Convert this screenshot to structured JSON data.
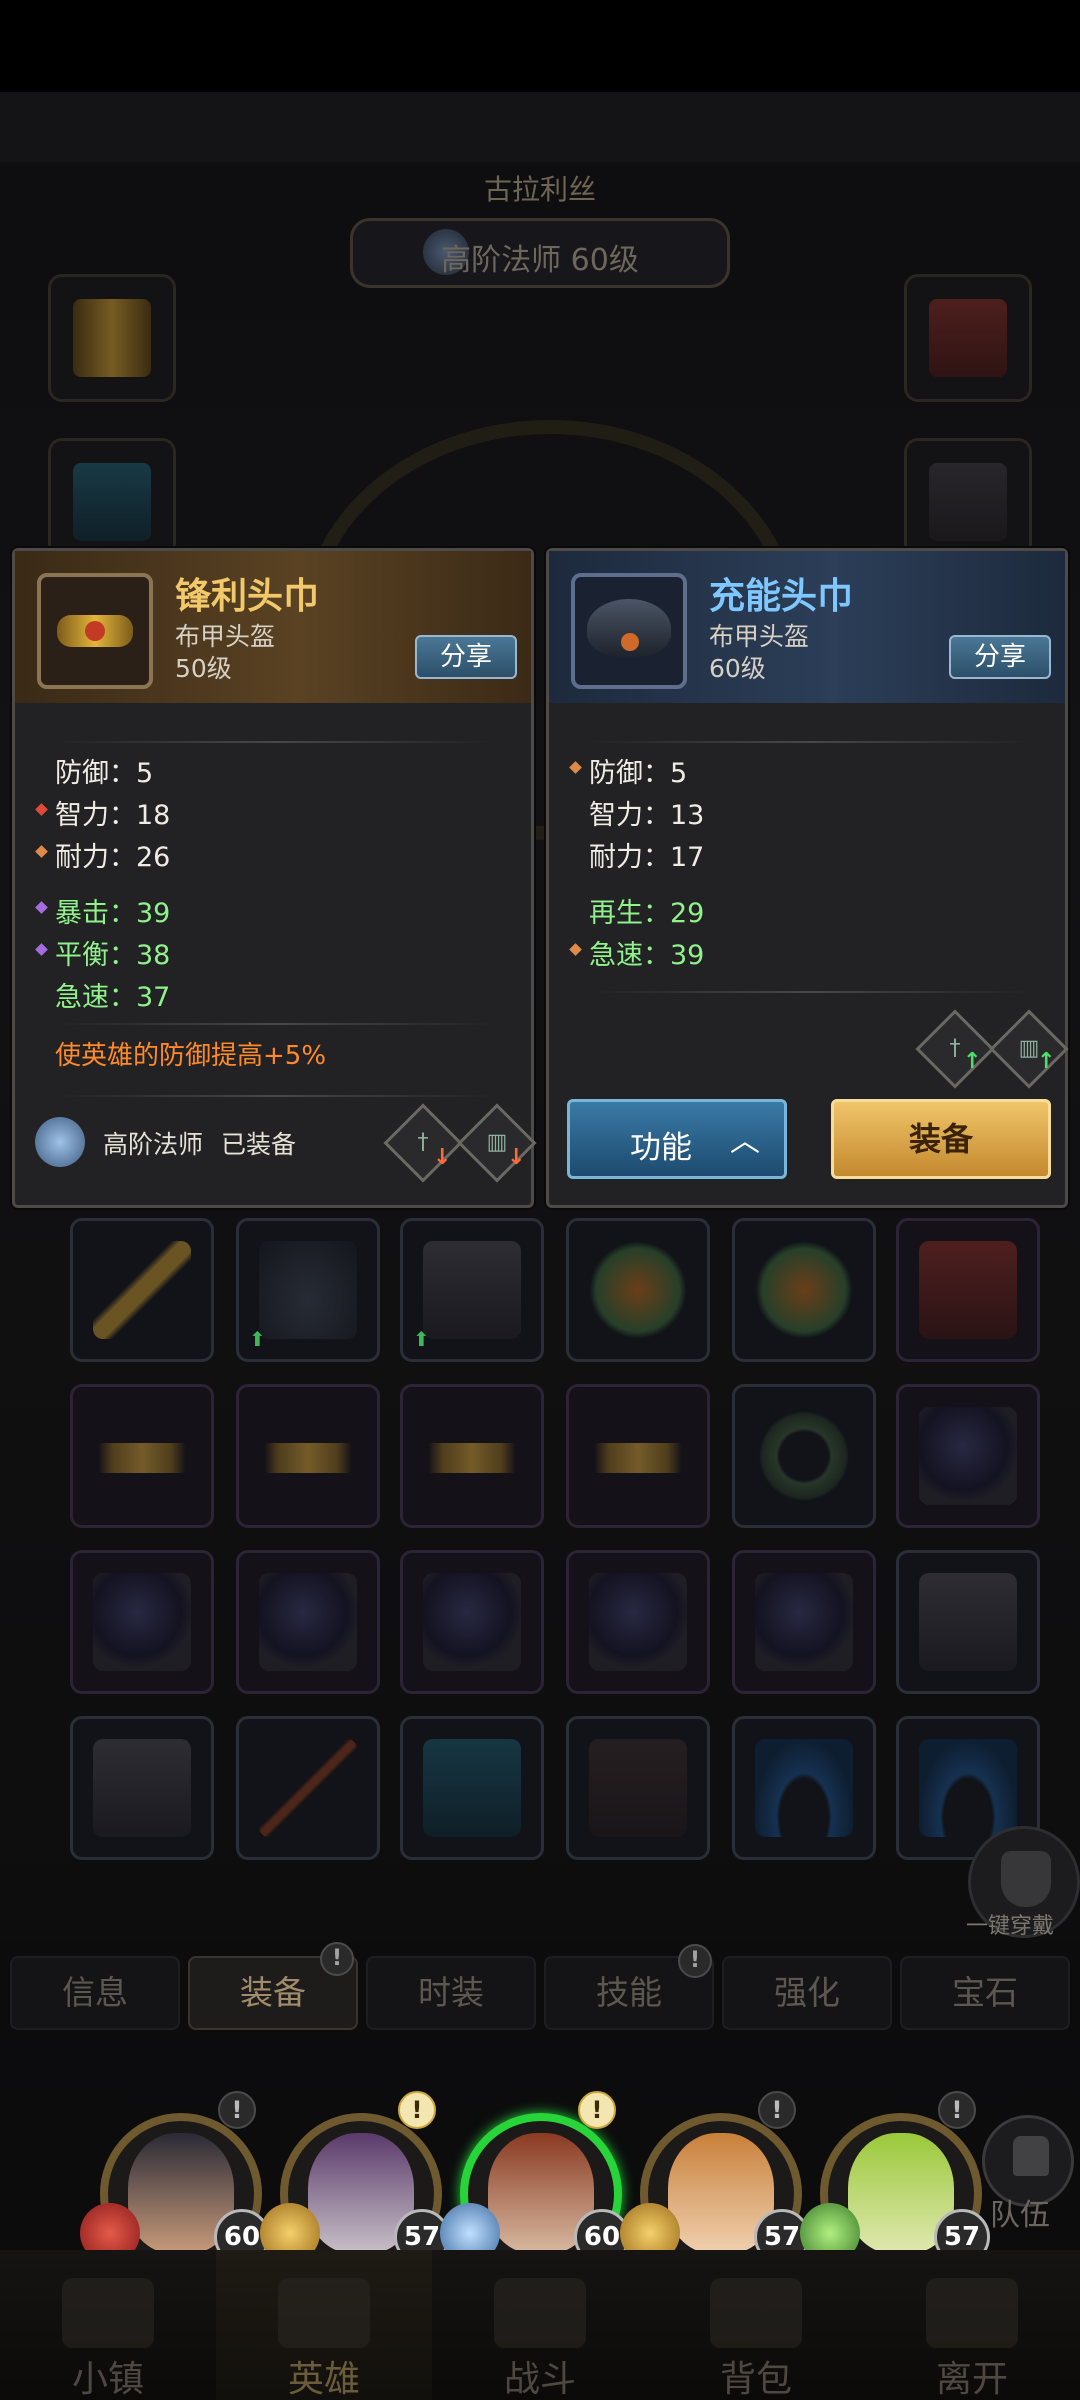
{
  "hero": {
    "name": "古拉利丝",
    "class_level": "高阶法师 60级"
  },
  "left_card": {
    "title": "锋利头巾",
    "subtitle": "布甲头盔",
    "level": "50级",
    "share_label": "分享",
    "stats": [
      {
        "label": "防御：5",
        "color": "white",
        "marker": ""
      },
      {
        "label": "智力：18",
        "color": "white",
        "marker": "red"
      },
      {
        "label": "耐力：26",
        "color": "white",
        "marker": "orange"
      },
      {
        "label": "暴击：39",
        "color": "green",
        "marker": "purple"
      },
      {
        "label": "平衡：38",
        "color": "green",
        "marker": "purple"
      },
      {
        "label": "急速：37",
        "color": "green",
        "marker": ""
      }
    ],
    "effect": "使英雄的防御提高+5%",
    "equipped_class": "高阶法师",
    "equipped_status": "已装备"
  },
  "right_card": {
    "title": "充能头巾",
    "subtitle": "布甲头盔",
    "level": "60级",
    "share_label": "分享",
    "stats": [
      {
        "label": "防御：5",
        "color": "white",
        "marker": "orange"
      },
      {
        "label": "智力：13",
        "color": "white",
        "marker": ""
      },
      {
        "label": "耐力：17",
        "color": "white",
        "marker": ""
      },
      {
        "label": "再生：29",
        "color": "green",
        "marker": ""
      },
      {
        "label": "急速：39",
        "color": "green",
        "marker": "orange"
      }
    ],
    "function_label": "功能",
    "equip_label": "装备"
  },
  "quick_equip_label": "一键穿戴",
  "tabs": [
    {
      "label": "信息",
      "badge": ""
    },
    {
      "label": "装备",
      "badge": "!"
    },
    {
      "label": "时装",
      "badge": ""
    },
    {
      "label": "技能",
      "badge": "!"
    },
    {
      "label": "强化",
      "badge": ""
    },
    {
      "label": "宝石",
      "badge": ""
    }
  ],
  "team": {
    "members": [
      {
        "level": "60",
        "alert": "!"
      },
      {
        "level": "57",
        "alert": "!"
      },
      {
        "level": "60",
        "alert": "!"
      },
      {
        "level": "57",
        "alert": "!"
      },
      {
        "level": "57",
        "alert": "!"
      }
    ],
    "team_label": "队伍"
  },
  "nav": [
    {
      "label": "小镇"
    },
    {
      "label": "英雄"
    },
    {
      "label": "战斗"
    },
    {
      "label": "背包"
    },
    {
      "label": "离开"
    }
  ],
  "colors": {
    "gold_title": "#f1c86a",
    "blue_title": "#7fc7ff",
    "green_stat": "#8ff28a",
    "effect_orange": "#ff8a2a"
  }
}
